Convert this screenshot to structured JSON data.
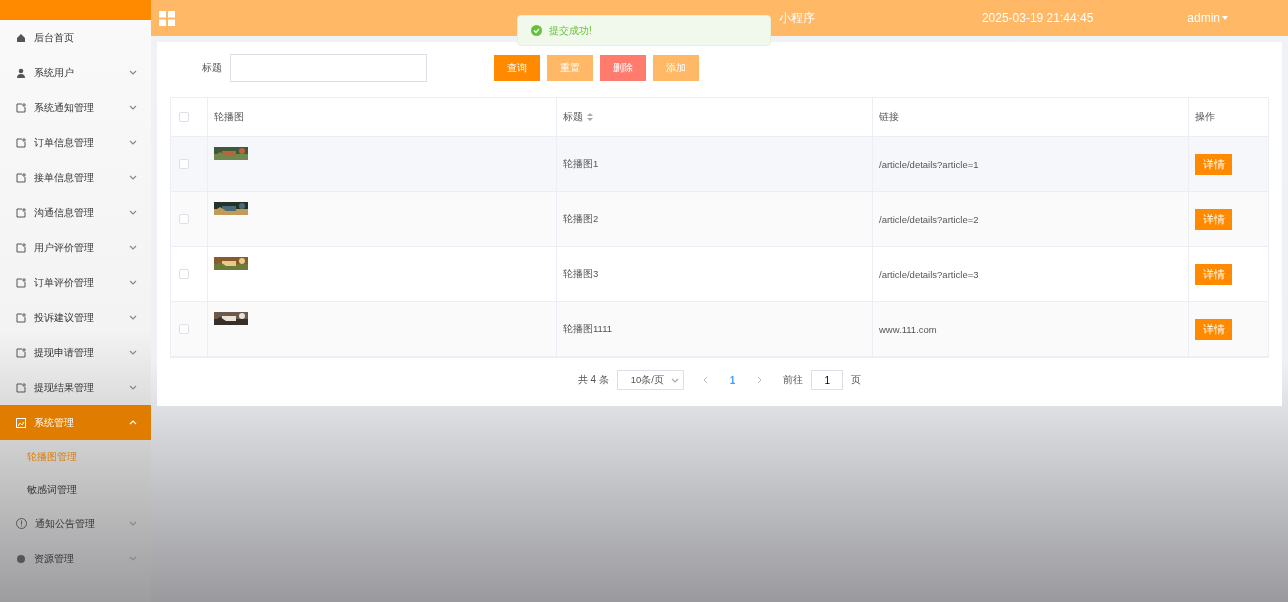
{
  "sidebar": {
    "items": [
      {
        "label": "后台首页",
        "selected": false
      },
      {
        "label": "系统用户",
        "expanded": false,
        "selected": false
      },
      {
        "label": "系统通知管理",
        "expanded": false,
        "selected": false
      },
      {
        "label": "订单信息管理",
        "expanded": false,
        "selected": false
      },
      {
        "label": "接单信息管理",
        "expanded": false,
        "selected": false
      },
      {
        "label": "沟通信息管理",
        "expanded": false,
        "selected": false
      },
      {
        "label": "用户评价管理",
        "expanded": false,
        "selected": false
      },
      {
        "label": "订单评价管理",
        "expanded": false,
        "selected": false
      },
      {
        "label": "投诉建议管理",
        "expanded": false,
        "selected": false
      },
      {
        "label": "提现申请管理",
        "expanded": false,
        "selected": false
      },
      {
        "label": "提现结果管理",
        "expanded": false,
        "selected": false
      },
      {
        "label": "系统管理",
        "expanded": true,
        "selected": true,
        "children": [
          {
            "label": "轮播图管理",
            "selected": true
          },
          {
            "label": "敏感词管理",
            "selected": false
          }
        ]
      },
      {
        "label": "通知公告管理",
        "expanded": false,
        "selected": false
      },
      {
        "label": "资源管理",
        "expanded": false,
        "selected": false
      }
    ]
  },
  "header": {
    "title": "小程序",
    "datetime": "2025-03-19 21:44:45",
    "user": "admin"
  },
  "toast": {
    "message": "提交成功!"
  },
  "search": {
    "label": "标题"
  },
  "buttons": [
    {
      "label": "查询",
      "kind": "primary"
    },
    {
      "label": "重置",
      "kind": "light"
    },
    {
      "label": "删除",
      "kind": "danger"
    },
    {
      "label": "添加",
      "kind": "light"
    }
  ],
  "table": {
    "select_all_checked": false,
    "columns": [
      "轮播图",
      "标题",
      "链接",
      "操作"
    ],
    "rows": [
      {
        "checked": false,
        "title": "轮播图1",
        "link": "/article/details?article=1",
        "action": "详情"
      },
      {
        "checked": false,
        "title": "轮播图2",
        "link": "/article/details?article=2",
        "action": "详情"
      },
      {
        "checked": false,
        "title": "轮播图3",
        "link": "/article/details?article=3",
        "action": "详情"
      },
      {
        "checked": false,
        "title": "轮播图1111",
        "link": "www.111.com",
        "action": "详情"
      }
    ]
  },
  "pagination": {
    "total": "共 4 条",
    "page_size": "10条/页",
    "pages": [
      {
        "label": "1",
        "selected": true
      }
    ],
    "goto_label": "前往",
    "goto_value": "1",
    "goto_suffix": "页"
  }
}
